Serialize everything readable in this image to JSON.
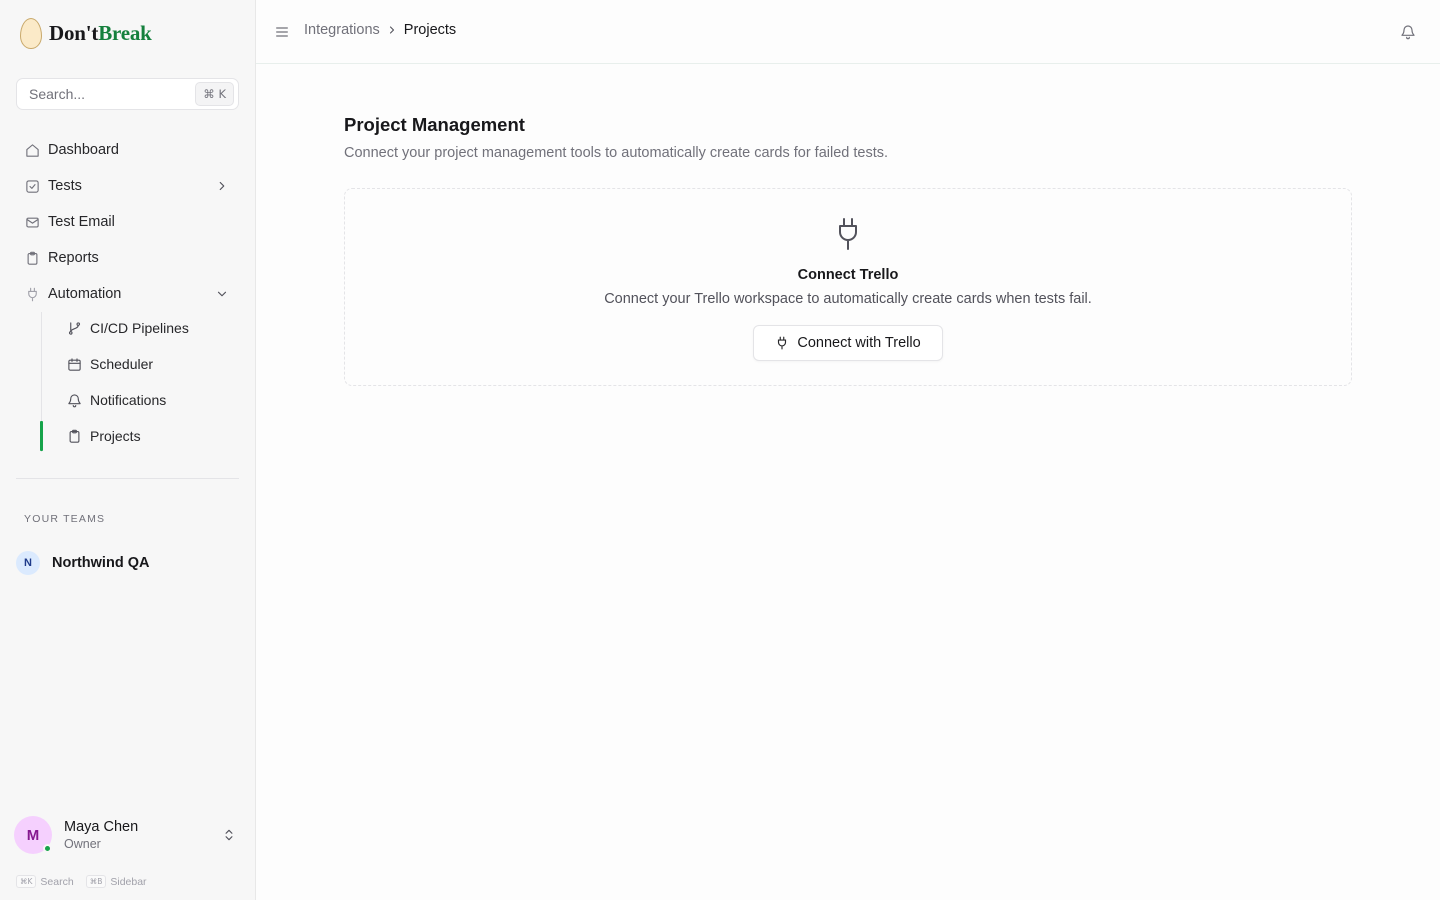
{
  "brand": {
    "name_dark": "Don't",
    "name_accent": "Break",
    "accent_color": "#15803d"
  },
  "search": {
    "placeholder": "Search...",
    "shortcut": "⌘ K"
  },
  "nav": [
    {
      "label": "Dashboard",
      "icon": "home-icon"
    },
    {
      "label": "Tests",
      "icon": "check-square-icon",
      "expandable": true
    },
    {
      "label": "Test Email",
      "icon": "mail-icon"
    },
    {
      "label": "Reports",
      "icon": "clipboard-icon"
    },
    {
      "label": "Automation",
      "icon": "plug-icon",
      "expanded": true
    }
  ],
  "automation_items": [
    {
      "label": "CI/CD Pipelines",
      "icon": "git-branch-icon"
    },
    {
      "label": "Scheduler",
      "icon": "calendar-icon"
    },
    {
      "label": "Notifications",
      "icon": "bell-icon"
    },
    {
      "label": "Projects",
      "icon": "clipboard-icon",
      "active": true
    }
  ],
  "teams": {
    "label": "Your Teams",
    "items": [
      {
        "initial": "N",
        "name": "Northwind QA"
      }
    ]
  },
  "user": {
    "initial": "M",
    "name": "Maya Chen",
    "role": "Owner",
    "status": "online"
  },
  "hints": [
    {
      "keys": "⌘K",
      "label": "Search"
    },
    {
      "keys": "⌘B",
      "label": "Sidebar"
    }
  ],
  "breadcrumb": {
    "parent": "Integrations",
    "current": "Projects"
  },
  "page": {
    "title": "Project Management",
    "description": "Connect your project management tools to automatically create cards for failed tests."
  },
  "trello_card": {
    "title": "Connect Trello",
    "description": "Connect your Trello workspace to automatically create cards when tests fail.",
    "button_label": "Connect with Trello"
  },
  "colors": {
    "active_indicator": "#16a34a",
    "sidebar_bg": "#f7f7f7"
  }
}
